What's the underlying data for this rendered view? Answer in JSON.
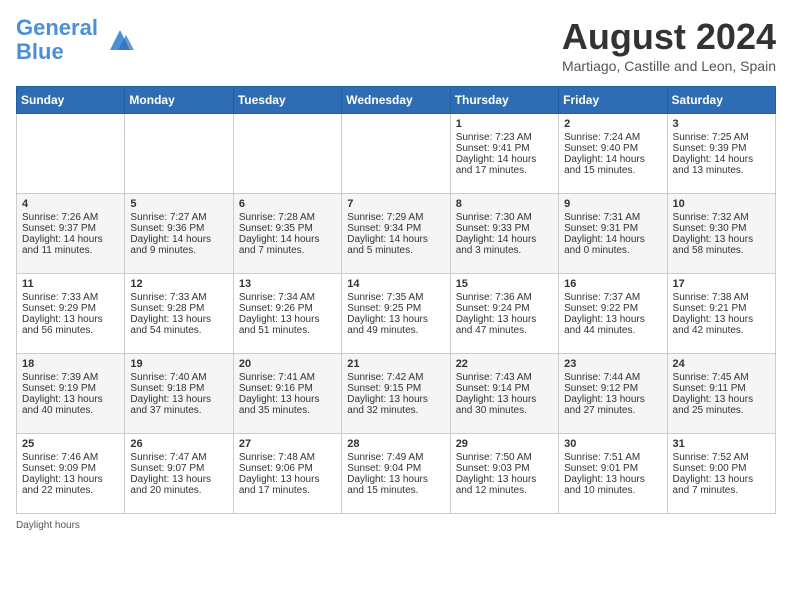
{
  "header": {
    "logo_line1": "General",
    "logo_line2": "Blue",
    "month": "August 2024",
    "location": "Martiago, Castille and Leon, Spain"
  },
  "days_of_week": [
    "Sunday",
    "Monday",
    "Tuesday",
    "Wednesday",
    "Thursday",
    "Friday",
    "Saturday"
  ],
  "footer": {
    "daylight_label": "Daylight hours"
  },
  "weeks": [
    {
      "cells": [
        {
          "day": "",
          "content": ""
        },
        {
          "day": "",
          "content": ""
        },
        {
          "day": "",
          "content": ""
        },
        {
          "day": "",
          "content": ""
        },
        {
          "day": "1",
          "content": "Sunrise: 7:23 AM\nSunset: 9:41 PM\nDaylight: 14 hours and 17 minutes."
        },
        {
          "day": "2",
          "content": "Sunrise: 7:24 AM\nSunset: 9:40 PM\nDaylight: 14 hours and 15 minutes."
        },
        {
          "day": "3",
          "content": "Sunrise: 7:25 AM\nSunset: 9:39 PM\nDaylight: 14 hours and 13 minutes."
        }
      ]
    },
    {
      "cells": [
        {
          "day": "4",
          "content": "Sunrise: 7:26 AM\nSunset: 9:37 PM\nDaylight: 14 hours and 11 minutes."
        },
        {
          "day": "5",
          "content": "Sunrise: 7:27 AM\nSunset: 9:36 PM\nDaylight: 14 hours and 9 minutes."
        },
        {
          "day": "6",
          "content": "Sunrise: 7:28 AM\nSunset: 9:35 PM\nDaylight: 14 hours and 7 minutes."
        },
        {
          "day": "7",
          "content": "Sunrise: 7:29 AM\nSunset: 9:34 PM\nDaylight: 14 hours and 5 minutes."
        },
        {
          "day": "8",
          "content": "Sunrise: 7:30 AM\nSunset: 9:33 PM\nDaylight: 14 hours and 3 minutes."
        },
        {
          "day": "9",
          "content": "Sunrise: 7:31 AM\nSunset: 9:31 PM\nDaylight: 14 hours and 0 minutes."
        },
        {
          "day": "10",
          "content": "Sunrise: 7:32 AM\nSunset: 9:30 PM\nDaylight: 13 hours and 58 minutes."
        }
      ]
    },
    {
      "cells": [
        {
          "day": "11",
          "content": "Sunrise: 7:33 AM\nSunset: 9:29 PM\nDaylight: 13 hours and 56 minutes."
        },
        {
          "day": "12",
          "content": "Sunrise: 7:33 AM\nSunset: 9:28 PM\nDaylight: 13 hours and 54 minutes."
        },
        {
          "day": "13",
          "content": "Sunrise: 7:34 AM\nSunset: 9:26 PM\nDaylight: 13 hours and 51 minutes."
        },
        {
          "day": "14",
          "content": "Sunrise: 7:35 AM\nSunset: 9:25 PM\nDaylight: 13 hours and 49 minutes."
        },
        {
          "day": "15",
          "content": "Sunrise: 7:36 AM\nSunset: 9:24 PM\nDaylight: 13 hours and 47 minutes."
        },
        {
          "day": "16",
          "content": "Sunrise: 7:37 AM\nSunset: 9:22 PM\nDaylight: 13 hours and 44 minutes."
        },
        {
          "day": "17",
          "content": "Sunrise: 7:38 AM\nSunset: 9:21 PM\nDaylight: 13 hours and 42 minutes."
        }
      ]
    },
    {
      "cells": [
        {
          "day": "18",
          "content": "Sunrise: 7:39 AM\nSunset: 9:19 PM\nDaylight: 13 hours and 40 minutes."
        },
        {
          "day": "19",
          "content": "Sunrise: 7:40 AM\nSunset: 9:18 PM\nDaylight: 13 hours and 37 minutes."
        },
        {
          "day": "20",
          "content": "Sunrise: 7:41 AM\nSunset: 9:16 PM\nDaylight: 13 hours and 35 minutes."
        },
        {
          "day": "21",
          "content": "Sunrise: 7:42 AM\nSunset: 9:15 PM\nDaylight: 13 hours and 32 minutes."
        },
        {
          "day": "22",
          "content": "Sunrise: 7:43 AM\nSunset: 9:14 PM\nDaylight: 13 hours and 30 minutes."
        },
        {
          "day": "23",
          "content": "Sunrise: 7:44 AM\nSunset: 9:12 PM\nDaylight: 13 hours and 27 minutes."
        },
        {
          "day": "24",
          "content": "Sunrise: 7:45 AM\nSunset: 9:11 PM\nDaylight: 13 hours and 25 minutes."
        }
      ]
    },
    {
      "cells": [
        {
          "day": "25",
          "content": "Sunrise: 7:46 AM\nSunset: 9:09 PM\nDaylight: 13 hours and 22 minutes."
        },
        {
          "day": "26",
          "content": "Sunrise: 7:47 AM\nSunset: 9:07 PM\nDaylight: 13 hours and 20 minutes."
        },
        {
          "day": "27",
          "content": "Sunrise: 7:48 AM\nSunset: 9:06 PM\nDaylight: 13 hours and 17 minutes."
        },
        {
          "day": "28",
          "content": "Sunrise: 7:49 AM\nSunset: 9:04 PM\nDaylight: 13 hours and 15 minutes."
        },
        {
          "day": "29",
          "content": "Sunrise: 7:50 AM\nSunset: 9:03 PM\nDaylight: 13 hours and 12 minutes."
        },
        {
          "day": "30",
          "content": "Sunrise: 7:51 AM\nSunset: 9:01 PM\nDaylight: 13 hours and 10 minutes."
        },
        {
          "day": "31",
          "content": "Sunrise: 7:52 AM\nSunset: 9:00 PM\nDaylight: 13 hours and 7 minutes."
        }
      ]
    }
  ]
}
